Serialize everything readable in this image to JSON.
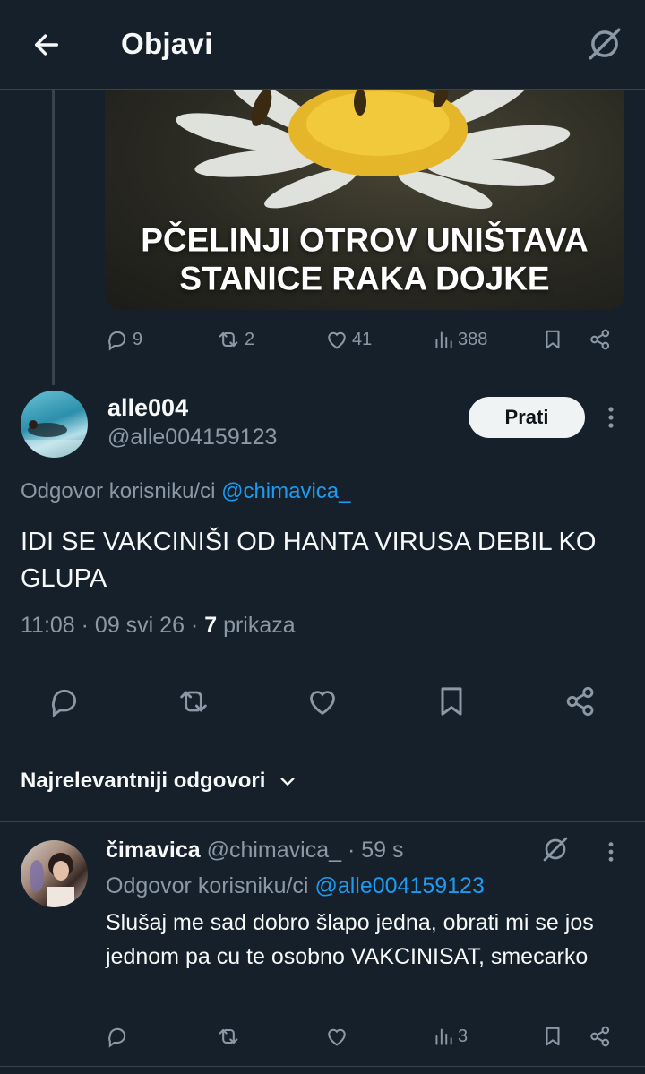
{
  "header": {
    "title": "Objavi"
  },
  "parent_tweet": {
    "media_caption": "PČELINJI OTROV UNIŠTAVA STANICE RAKA DOJKE",
    "stats": {
      "replies": "9",
      "reposts": "2",
      "likes": "41",
      "views": "388"
    }
  },
  "tweet": {
    "display_name": "alle004",
    "handle": "@alle004159123",
    "follow_label": "Prati",
    "reply_to_prefix": "Odgovor korisniku/ci",
    "reply_to_user": "@chimavica_",
    "text": "IDI SE VAKCINIŠI OD HANTA VIRUSA DEBIL KO GLUPA",
    "time_date": "11:08 · 09 svi 26 ·",
    "views_count": "7",
    "views_label": "prikaza"
  },
  "replies_sort": {
    "label": "Najrelevantniji odgovori"
  },
  "comment": {
    "display_name": "čimavica",
    "handle": "@chimavica_",
    "time": "· 59 s",
    "reply_to_prefix": "Odgovor korisniku/ci",
    "reply_to_user": "@alle004159123",
    "text": "Slušaj me sad dobro šlapo jedna, obrati mi se jos jednom pa cu te osobno VAKCINISAT, smecarko",
    "stats": {
      "views": "3"
    }
  },
  "colors": {
    "background": "#15202b",
    "accent": "#1d9bf0",
    "muted": "#8b98a5",
    "border": "#38444d"
  },
  "icons": [
    "back-arrow-icon",
    "grok-icon",
    "reply-icon",
    "repost-icon",
    "like-icon",
    "views-icon",
    "bookmark-icon",
    "share-icon",
    "more-icon",
    "chevron-down-icon"
  ]
}
